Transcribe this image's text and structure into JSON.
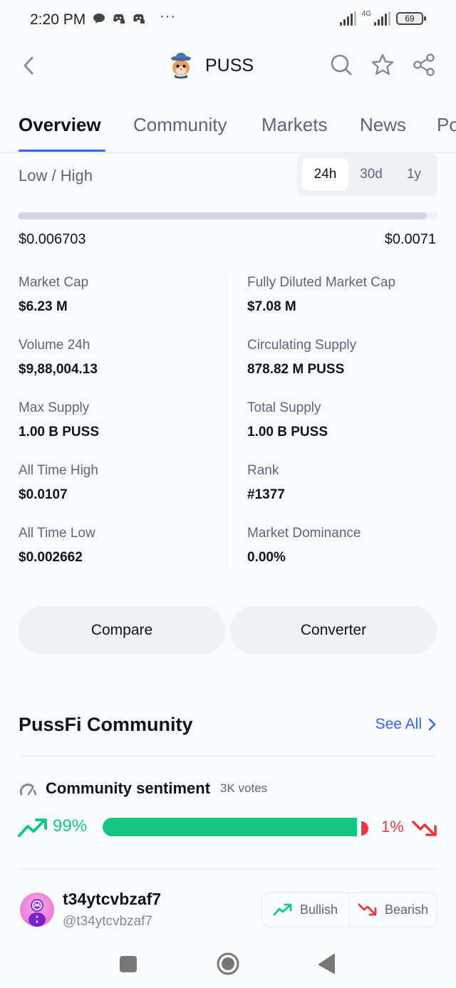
{
  "status_bar": {
    "time": "2:20 PM",
    "notification_icons": [
      "chat-bubble-icon",
      "discord-icon",
      "discord-icon"
    ],
    "more": "···",
    "network": "4G",
    "battery": "69"
  },
  "header": {
    "coin_symbol": "PUSS",
    "back_icon": "chevron-left-icon",
    "actions": [
      "search-icon",
      "star-icon",
      "share-icon"
    ]
  },
  "tabs": [
    {
      "label": "Overview",
      "active": true
    },
    {
      "label": "Community",
      "active": false
    },
    {
      "label": "Markets",
      "active": false
    },
    {
      "label": "News",
      "active": false
    },
    {
      "label": "Po",
      "active": false
    }
  ],
  "low_high": {
    "label": "Low / High",
    "ranges": [
      {
        "label": "24h",
        "active": true
      },
      {
        "label": "30d",
        "active": false
      },
      {
        "label": "1y",
        "active": false
      }
    ],
    "low": "$0.006703",
    "high": "$0.0071",
    "position_fraction": 0.975
  },
  "stats": {
    "left": [
      {
        "label": "Market Cap",
        "value": "$6.23 M"
      },
      {
        "label": "Volume 24h",
        "value": "$9,88,004.13"
      },
      {
        "label": "Max Supply",
        "value": "1.00 B PUSS"
      },
      {
        "label": "All Time High",
        "value": "$0.0107"
      },
      {
        "label": "All Time Low",
        "value": "$0.002662"
      }
    ],
    "right": [
      {
        "label": "Fully Diluted Market Cap",
        "value": "$7.08 M"
      },
      {
        "label": "Circulating Supply",
        "value": "878.82 M PUSS"
      },
      {
        "label": "Total Supply",
        "value": "1.00 B PUSS"
      },
      {
        "label": "Rank",
        "value": "#1377"
      },
      {
        "label": "Market Dominance",
        "value": "0.00%"
      }
    ]
  },
  "actions": {
    "compare": "Compare",
    "converter": "Converter"
  },
  "community": {
    "title": "PussFi Community",
    "see_all": "See All",
    "sentiment": {
      "title": "Community sentiment",
      "votes": "3K votes",
      "bullish_pct": "99%",
      "bearish_pct": "1%",
      "bullish_fraction": 0.99,
      "bullish_color": "#16c784",
      "bearish_color": "#ea3943"
    },
    "post": {
      "name": "t34ytcvbzaf7",
      "handle": "@t34ytcvbzaf7",
      "bullish_label": "Bullish",
      "bearish_label": "Bearish"
    }
  },
  "colors": {
    "accent": "#3861fb",
    "text_primary": "#0d1421",
    "text_secondary": "#58667e"
  },
  "nav_bar": [
    "recents-icon",
    "home-icon",
    "back-icon"
  ]
}
